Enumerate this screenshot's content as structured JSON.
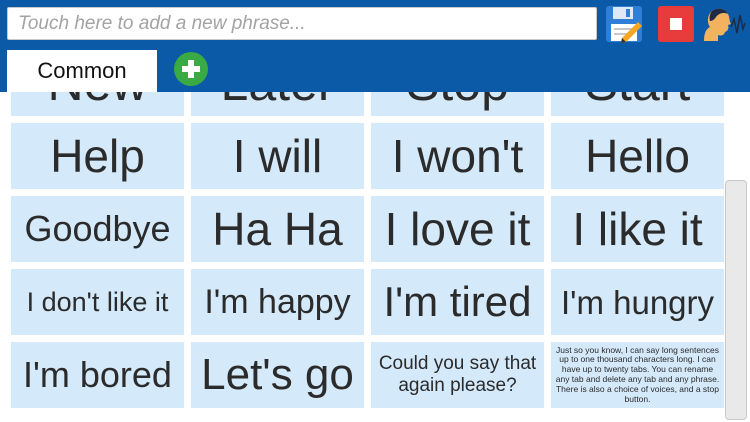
{
  "input": {
    "placeholder": "Touch here to add a new phrase..."
  },
  "toolbar": {
    "save_icon": "floppy-disk-pencil-icon",
    "stop_icon": "stop-icon",
    "voice_icon": "speaking-head-icon",
    "stop_color": "#e83c3c",
    "bar_color": "#0a5aa8"
  },
  "tabs": [
    {
      "label": "Common"
    }
  ],
  "add_tab_icon": "plus-circle-icon",
  "phrases": [
    "New",
    "Later",
    "Stop",
    "Start",
    "Help",
    "I will",
    "I won't",
    "Hello",
    "Goodbye",
    "Ha Ha",
    "I love it",
    "I like it",
    "I don't like it",
    "I'm happy",
    "I'm tired",
    "I'm hungry",
    "I'm bored",
    "Let's go",
    "Could you say that again please?",
    "Just so you know, I can say long sentences up to one thousand characters long. I can have up to twenty tabs. You can rename any tab and delete any tab and any phrase. There is also a choice of voices, and a stop button."
  ],
  "cell_color": "#d4e9fa"
}
